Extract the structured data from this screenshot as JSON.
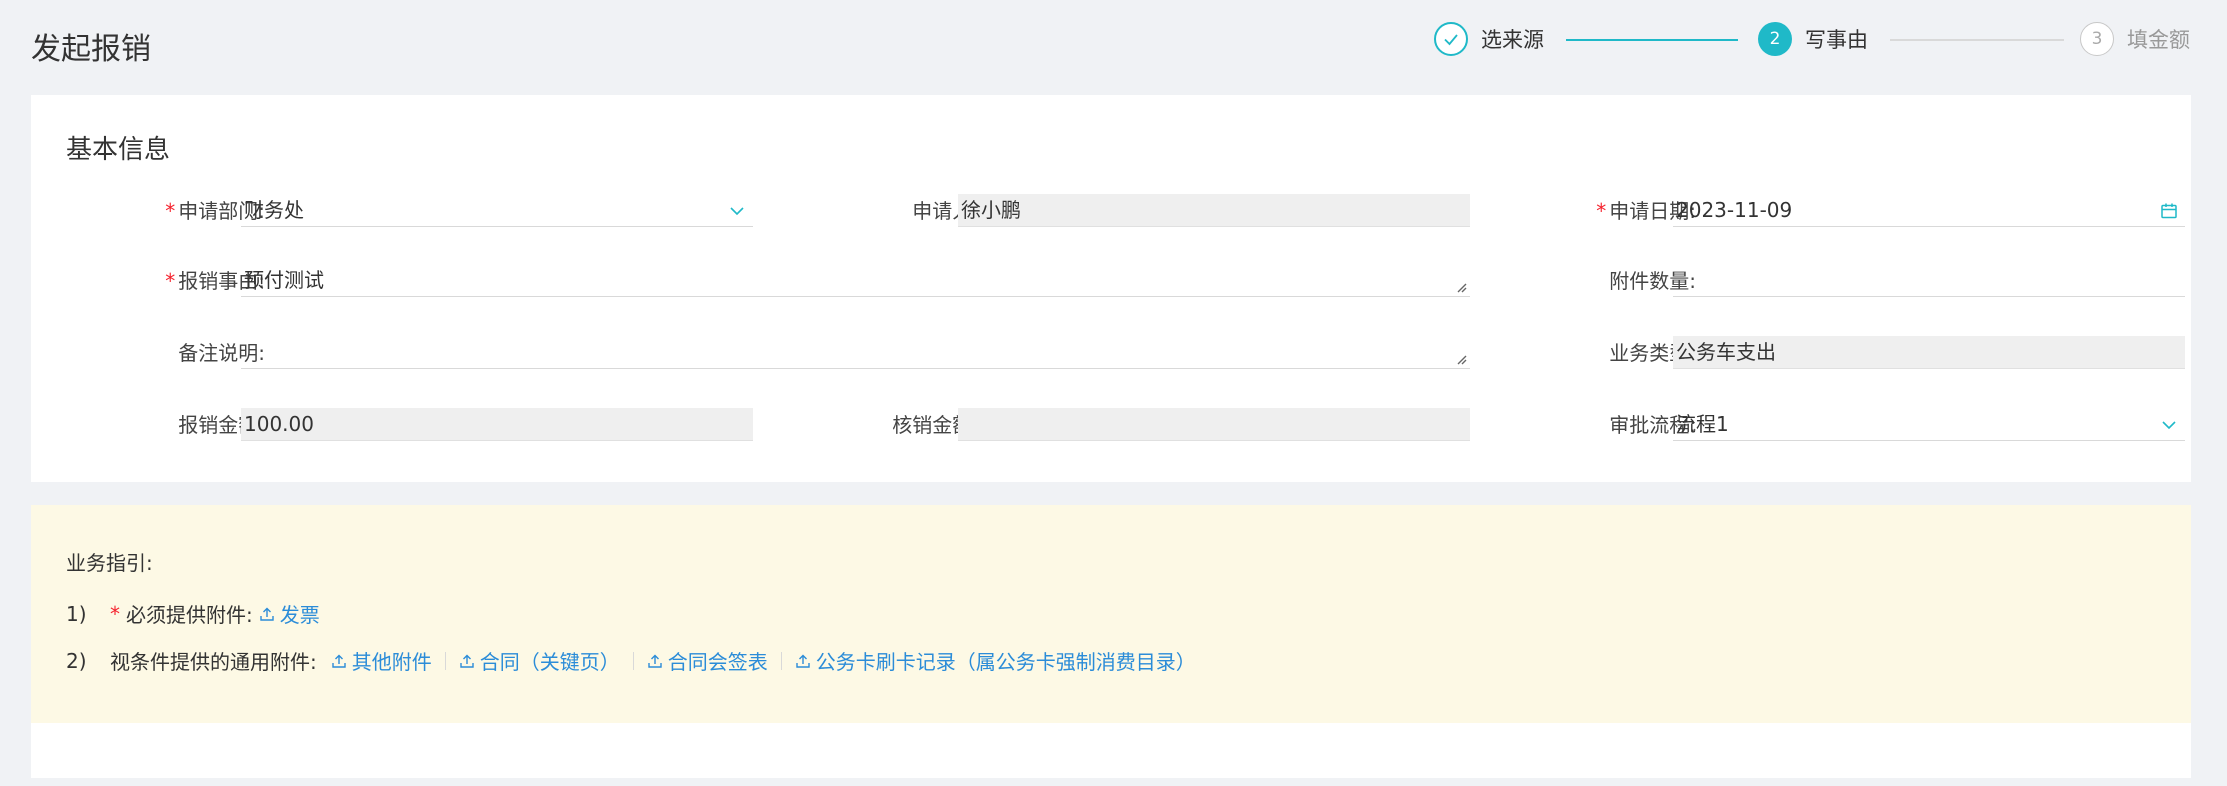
{
  "page": {
    "title": "发起报销"
  },
  "steps": [
    {
      "label": "选来源",
      "status": "done",
      "number": ""
    },
    {
      "label": "写事由",
      "status": "active",
      "number": "2"
    },
    {
      "label": "填金额",
      "status": "pending",
      "number": "3"
    }
  ],
  "basic_info": {
    "title": "基本信息",
    "fields": {
      "dept": {
        "label": "申请部门:",
        "required": "*",
        "value": "财务处"
      },
      "applicant": {
        "label": "申请人:",
        "value": "徐小鹏"
      },
      "date": {
        "label": "申请日期:",
        "required": "*",
        "value": "2023-11-09"
      },
      "reason": {
        "label": "报销事由:",
        "required": "*",
        "value": "预付测试"
      },
      "attachments": {
        "label": "附件数量:",
        "value": ""
      },
      "remark": {
        "label": "备注说明:",
        "value": ""
      },
      "biz_type": {
        "label": "业务类型:",
        "value": "公务车支出"
      },
      "amount": {
        "label": "报销金额:",
        "value": "100.00"
      },
      "writeoff": {
        "label": "核销金额:",
        "value": ""
      },
      "flow": {
        "label": "审批流程:",
        "value": "流程1"
      }
    }
  },
  "guide": {
    "title": "业务指引:",
    "row1": {
      "num": "1)",
      "required": "*",
      "text": "必须提供附件:",
      "links": [
        "发票"
      ]
    },
    "row2": {
      "num": "2)",
      "text": "视条件提供的通用附件:",
      "links": [
        "其他附件",
        "合同（关键页）",
        "合同会签表",
        "公务卡刷卡记录（属公务卡强制消费目录）"
      ]
    }
  },
  "colors": {
    "accent": "#1fb9c8",
    "link": "#2b8cd8",
    "required": "#f5222d",
    "guide_bg": "#fdf9e5"
  }
}
